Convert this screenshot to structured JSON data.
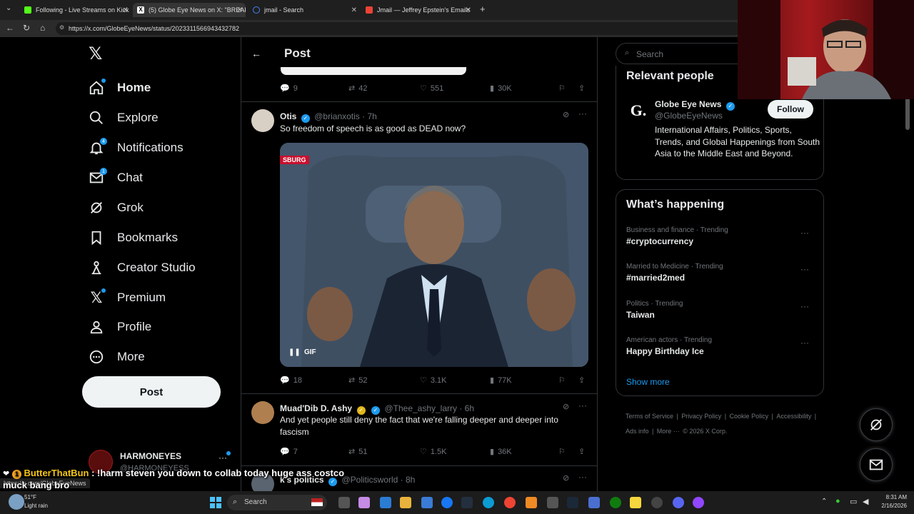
{
  "browser": {
    "tabs": [
      {
        "title": "Following - Live Streams on Kick",
        "color": "#53fc18"
      },
      {
        "title": "(5) Globe Eye News on X: \"BREAKI",
        "color": "#ffffff"
      },
      {
        "title": "jmail - Search",
        "color": "#4285f4"
      },
      {
        "title": "Jmail — Jeffrey Epstein's Emails",
        "color": "#ea4335"
      }
    ],
    "url": "https://x.com/GlobeEyeNews/status/2023311566943432782",
    "status_url": "https://x.com/GlobeEyeNews"
  },
  "sidebar": {
    "items": [
      {
        "label": "Home",
        "icon": "home-icon"
      },
      {
        "label": "Explore",
        "icon": "search-icon"
      },
      {
        "label": "Notifications",
        "icon": "bell-icon",
        "badge": "4"
      },
      {
        "label": "Chat",
        "icon": "mail-icon",
        "badge": "1"
      },
      {
        "label": "Grok",
        "icon": "grok-icon"
      },
      {
        "label": "Bookmarks",
        "icon": "bookmark-icon"
      },
      {
        "label": "Creator Studio",
        "icon": "creator-icon"
      },
      {
        "label": "Premium",
        "icon": "x-icon"
      },
      {
        "label": "Profile",
        "icon": "person-icon"
      },
      {
        "label": "More",
        "icon": "more-icon"
      }
    ],
    "post_label": "Post",
    "account_name": "HARMONEYES",
    "account_handle": "@HARMONEYESS"
  },
  "header": {
    "title": "Post"
  },
  "feed": {
    "prev_stats": {
      "replies": "9",
      "reposts": "42",
      "likes": "551",
      "views": "30K"
    },
    "tweets": [
      {
        "name": "Otis",
        "handle": "@brianxotis · 7h",
        "text": "So freedom of speech is as good as DEAD now?",
        "media_label": "GIF",
        "media_watermark": "SBURG",
        "stats": {
          "replies": "18",
          "reposts": "52",
          "likes": "3.1K",
          "views": "77K"
        }
      },
      {
        "name": "Muad'Dib D. Ashy",
        "handle": "@Thee_ashy_larry · 6h",
        "text": "And yet people still deny the fact that we're falling deeper and deeper into fascism",
        "stats": {
          "replies": "7",
          "reposts": "51",
          "likes": "1.5K",
          "views": "36K"
        }
      },
      {
        "name": "k's politics",
        "handle": "@Politicsworld · 8h"
      }
    ]
  },
  "right": {
    "search_placeholder": "Search",
    "relevant_title": "Relevant people",
    "person": {
      "name": "Globe Eye News",
      "handle": "@GlobeEyeNews",
      "bio": "International Affairs, Politics, Sports, Trends, and Global Happenings from South Asia to the Middle East and Beyond.",
      "follow_label": "Follow"
    },
    "happening_title": "What’s happening",
    "trends": [
      {
        "meta": "Business and finance · Trending",
        "name": "#cryptocurrency"
      },
      {
        "meta": "Married to Medicine · Trending",
        "name": "#married2med"
      },
      {
        "meta": "Politics · Trending",
        "name": "Taiwan"
      },
      {
        "meta": "American actors · Trending",
        "name": "Happy Birthday Ice"
      }
    ],
    "show_more": "Show more",
    "footer": [
      "Terms of Service",
      "Privacy Policy",
      "Cookie Policy",
      "Accessibility",
      "Ads info",
      "More ···",
      "© 2026 X Corp."
    ]
  },
  "chat_overlay": {
    "user": "ButterThatBun",
    "message_line1": ": !harm steven you down to collab today huge ass costco",
    "message_line2": "muck bang bro"
  },
  "taskbar": {
    "weather_temp": "51°F",
    "weather_desc": "Light rain",
    "search_label": "Search",
    "time": "8:31 AM",
    "date": "2/16/2026"
  }
}
